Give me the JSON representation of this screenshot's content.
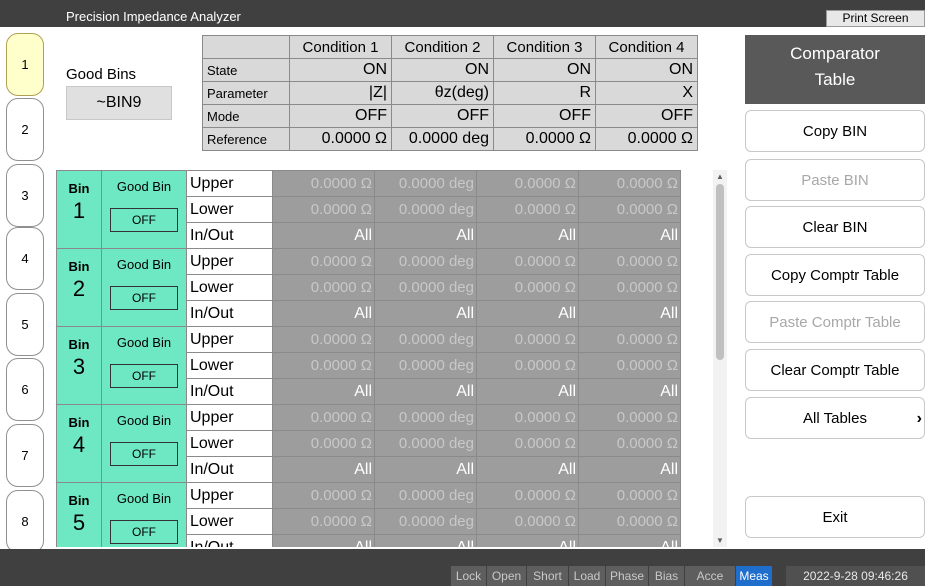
{
  "app": {
    "title": "Precision Impedance Analyzer",
    "print_screen": "Print Screen"
  },
  "side_tabs": [
    "1",
    "2",
    "3",
    "4",
    "5",
    "6",
    "7",
    "8"
  ],
  "good_bins": {
    "label": "Good Bins",
    "value": "~BIN9"
  },
  "conditions": {
    "headers": [
      "Condition 1",
      "Condition 2",
      "Condition 3",
      "Condition 4"
    ],
    "rows": [
      {
        "label": "State",
        "values": [
          "ON",
          "ON",
          "ON",
          "ON"
        ]
      },
      {
        "label": "Parameter",
        "values": [
          "|Z|",
          "θz(deg)",
          "R",
          "X"
        ]
      },
      {
        "label": "Mode",
        "values": [
          "OFF",
          "OFF",
          "OFF",
          "OFF"
        ]
      },
      {
        "label": "Reference",
        "values": [
          "0.0000 Ω",
          "0.0000 deg",
          "0.0000 Ω",
          "0.0000 Ω"
        ]
      }
    ]
  },
  "bins": [
    {
      "word": "Bin",
      "num": "1",
      "good": "Good Bin",
      "state": "OFF",
      "upper_label": "Upper",
      "lower_label": "Lower",
      "inout_label": "In/Out",
      "upper": [
        "0.0000 Ω",
        "0.0000 deg",
        "0.0000 Ω",
        "0.0000 Ω"
      ],
      "lower": [
        "0.0000 Ω",
        "0.0000 deg",
        "0.0000 Ω",
        "0.0000 Ω"
      ],
      "inout": [
        "All",
        "All",
        "All",
        "All"
      ]
    },
    {
      "word": "Bin",
      "num": "2",
      "good": "Good Bin",
      "state": "OFF",
      "upper_label": "Upper",
      "lower_label": "Lower",
      "inout_label": "In/Out",
      "upper": [
        "0.0000 Ω",
        "0.0000 deg",
        "0.0000 Ω",
        "0.0000 Ω"
      ],
      "lower": [
        "0.0000 Ω",
        "0.0000 deg",
        "0.0000 Ω",
        "0.0000 Ω"
      ],
      "inout": [
        "All",
        "All",
        "All",
        "All"
      ]
    },
    {
      "word": "Bin",
      "num": "3",
      "good": "Good Bin",
      "state": "OFF",
      "upper_label": "Upper",
      "lower_label": "Lower",
      "inout_label": "In/Out",
      "upper": [
        "0.0000 Ω",
        "0.0000 deg",
        "0.0000 Ω",
        "0.0000 Ω"
      ],
      "lower": [
        "0.0000 Ω",
        "0.0000 deg",
        "0.0000 Ω",
        "0.0000 Ω"
      ],
      "inout": [
        "All",
        "All",
        "All",
        "All"
      ]
    },
    {
      "word": "Bin",
      "num": "4",
      "good": "Good Bin",
      "state": "OFF",
      "upper_label": "Upper",
      "lower_label": "Lower",
      "inout_label": "In/Out",
      "upper": [
        "0.0000 Ω",
        "0.0000 deg",
        "0.0000 Ω",
        "0.0000 Ω"
      ],
      "lower": [
        "0.0000 Ω",
        "0.0000 deg",
        "0.0000 Ω",
        "0.0000 Ω"
      ],
      "inout": [
        "All",
        "All",
        "All",
        "All"
      ]
    },
    {
      "word": "Bin",
      "num": "5",
      "good": "Good Bin",
      "state": "OFF",
      "upper_label": "Upper",
      "lower_label": "Lower",
      "inout_label": "In/Out",
      "upper": [
        "0.0000 Ω",
        "0.0000 deg",
        "0.0000 Ω",
        "0.0000 Ω"
      ],
      "lower": [
        "0.0000 Ω",
        "0.0000 deg",
        "0.0000 Ω",
        "0.0000 Ω"
      ],
      "inout": [
        "All",
        "All",
        "All",
        "All"
      ]
    }
  ],
  "right_panel": {
    "header_line1": "Comparator",
    "header_line2": "Table",
    "copy_bin": "Copy BIN",
    "paste_bin": "Paste BIN",
    "clear_bin": "Clear BIN",
    "copy_table": "Copy Comptr Table",
    "paste_table": "Paste Comptr Table",
    "clear_table": "Clear Comptr Table",
    "all_tables": "All Tables",
    "all_tables_chevron": "›",
    "exit": "Exit"
  },
  "status": {
    "items": [
      "Lock",
      "Open",
      "Short",
      "Load",
      "Phase",
      "Bias",
      "Acce",
      "Meas"
    ],
    "active": "Meas",
    "datetime": "2022-9-28 09:46:26"
  },
  "colors": {
    "accent_green": "#6ee8c2",
    "meas_blue": "#1f6ecc",
    "bar_dark": "#404040"
  }
}
